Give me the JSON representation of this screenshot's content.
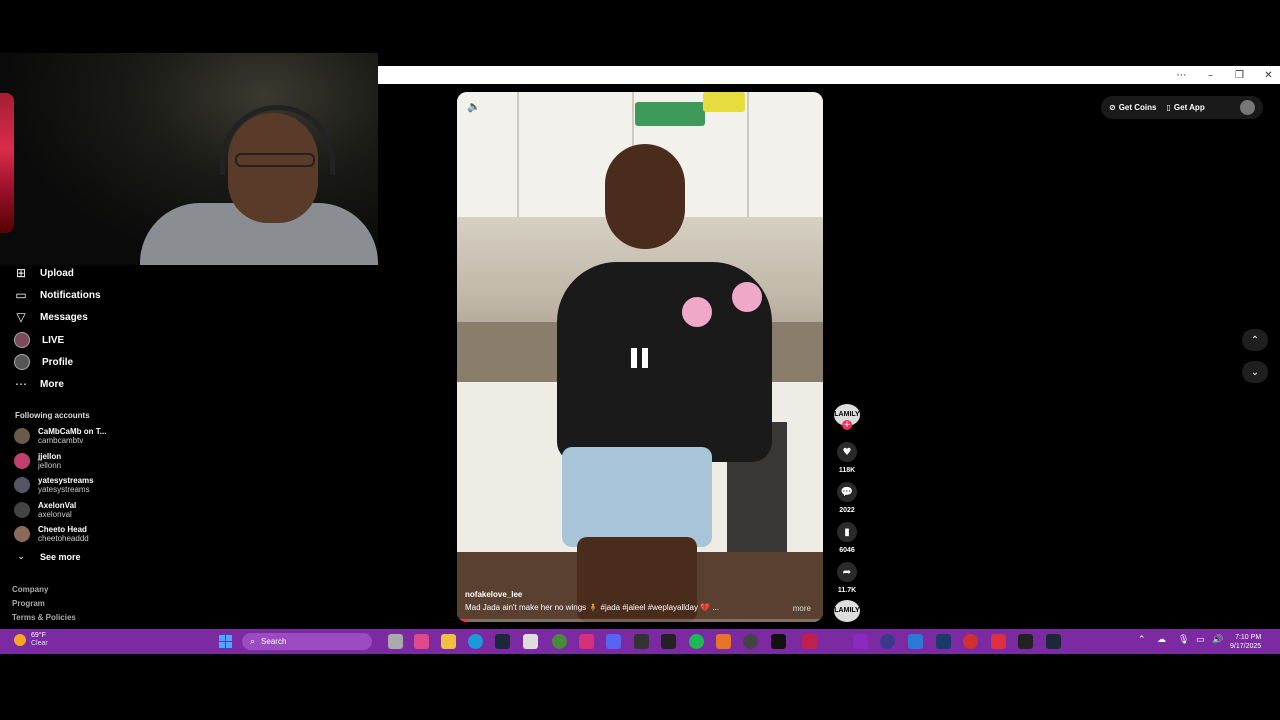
{
  "sidebar": {
    "items": [
      {
        "label": "Upload",
        "icon": "upload-icon"
      },
      {
        "label": "Notifications",
        "icon": "notifications-icon"
      },
      {
        "label": "Messages",
        "icon": "messages-icon"
      },
      {
        "label": "LIVE",
        "icon": "live-avatar-icon"
      },
      {
        "label": "Profile",
        "icon": "profile-avatar-icon"
      },
      {
        "label": "More",
        "icon": "more-icon"
      }
    ],
    "following_title": "Following accounts",
    "accounts": [
      {
        "name": "CaMbCaMb on T...",
        "handle": "cambcambtv",
        "color": "#6a5a4a"
      },
      {
        "name": "jjellon",
        "handle": "jellonn",
        "color": "#c04070"
      },
      {
        "name": "yatesystreams",
        "handle": "yatesystreams",
        "color": "#555566"
      },
      {
        "name": "AxelonVal",
        "handle": "axelonval",
        "color": "#444444"
      },
      {
        "name": "Cheeto Head",
        "handle": "cheetoheaddd",
        "color": "#8a6a5a"
      }
    ],
    "see_more": "See more",
    "footer": [
      "Company",
      "Program",
      "Terms & Policies"
    ]
  },
  "topbar": {
    "get_coins": "Get Coins",
    "get_app": "Get App"
  },
  "video": {
    "author": "nofakelove_lee",
    "caption": "Mad Jada ain't make her no wings 🧍 #jada #jaleel #weplayallday 💔 ...",
    "more": "more",
    "progress": 0.03
  },
  "actions": {
    "creator_label": "LAMILY",
    "likes": "118K",
    "comments": "2022",
    "saves": "6046",
    "shares": "11.7K"
  },
  "taskbar": {
    "temp": "69°F",
    "condition": "Clear",
    "search_placeholder": "Search",
    "time": "7:10 PM",
    "date": "9/17/2025"
  },
  "colors": {
    "accent": "#fe2c55",
    "taskbar": "#7b2aa1"
  }
}
